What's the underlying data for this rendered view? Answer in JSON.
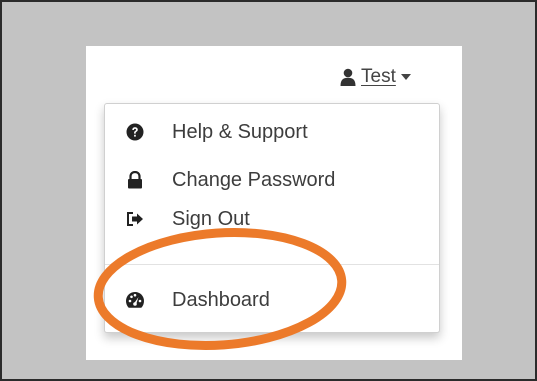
{
  "user_menu": {
    "username": "Test",
    "user_icon": "user-icon",
    "caret_icon": "caret-down-icon"
  },
  "dropdown": {
    "items": [
      {
        "label": "Help & Support",
        "icon": "question-circle-icon"
      },
      {
        "label": "Change Password",
        "icon": "lock-icon"
      },
      {
        "label": "Sign Out",
        "icon": "sign-out-icon"
      },
      {
        "label": "Dashboard",
        "icon": "dashboard-icon"
      }
    ]
  },
  "colors": {
    "background_gray": "#c3c3c3",
    "text": "#3d3d3d",
    "highlight_circle": "#ec7a2a",
    "frame_border": "#2b2b2b"
  }
}
